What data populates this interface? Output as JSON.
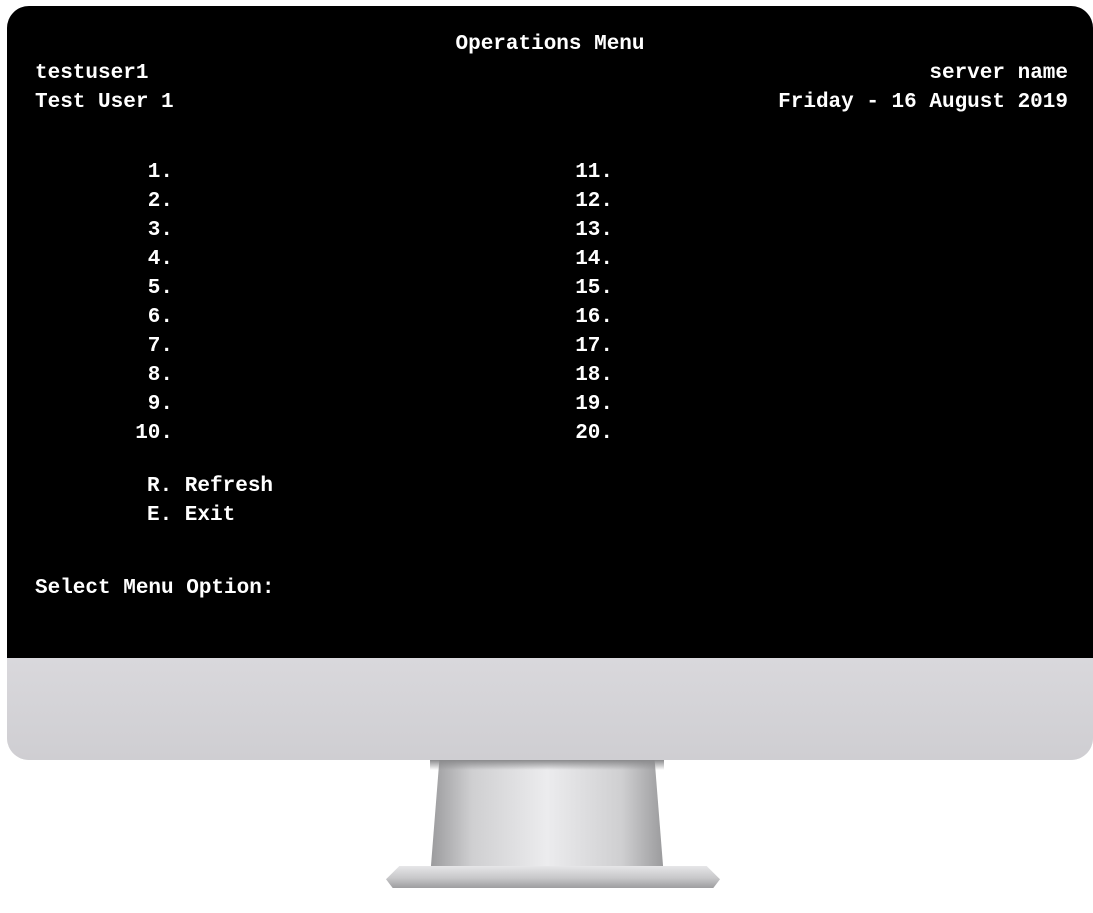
{
  "header": {
    "title": "Operations Menu",
    "user_id": "testuser1",
    "user_name": "Test User 1",
    "server": "server name",
    "date": "Friday - 16 August 2019"
  },
  "menu": {
    "left_items": [
      "1.",
      "2.",
      "3.",
      "4.",
      "5.",
      "6.",
      "7.",
      "8.",
      "9.",
      "10."
    ],
    "right_items": [
      "11.",
      "12.",
      "13.",
      "14.",
      "15.",
      "16.",
      "17.",
      "18.",
      "19.",
      "20."
    ],
    "refresh": "R. Refresh",
    "exit": "E. Exit"
  },
  "prompt": {
    "label": "Select Menu Option:",
    "value": ""
  },
  "colors": {
    "screen_background": "#000000",
    "screen_text": "#ffffff",
    "bezel": "#d6d5d9"
  }
}
